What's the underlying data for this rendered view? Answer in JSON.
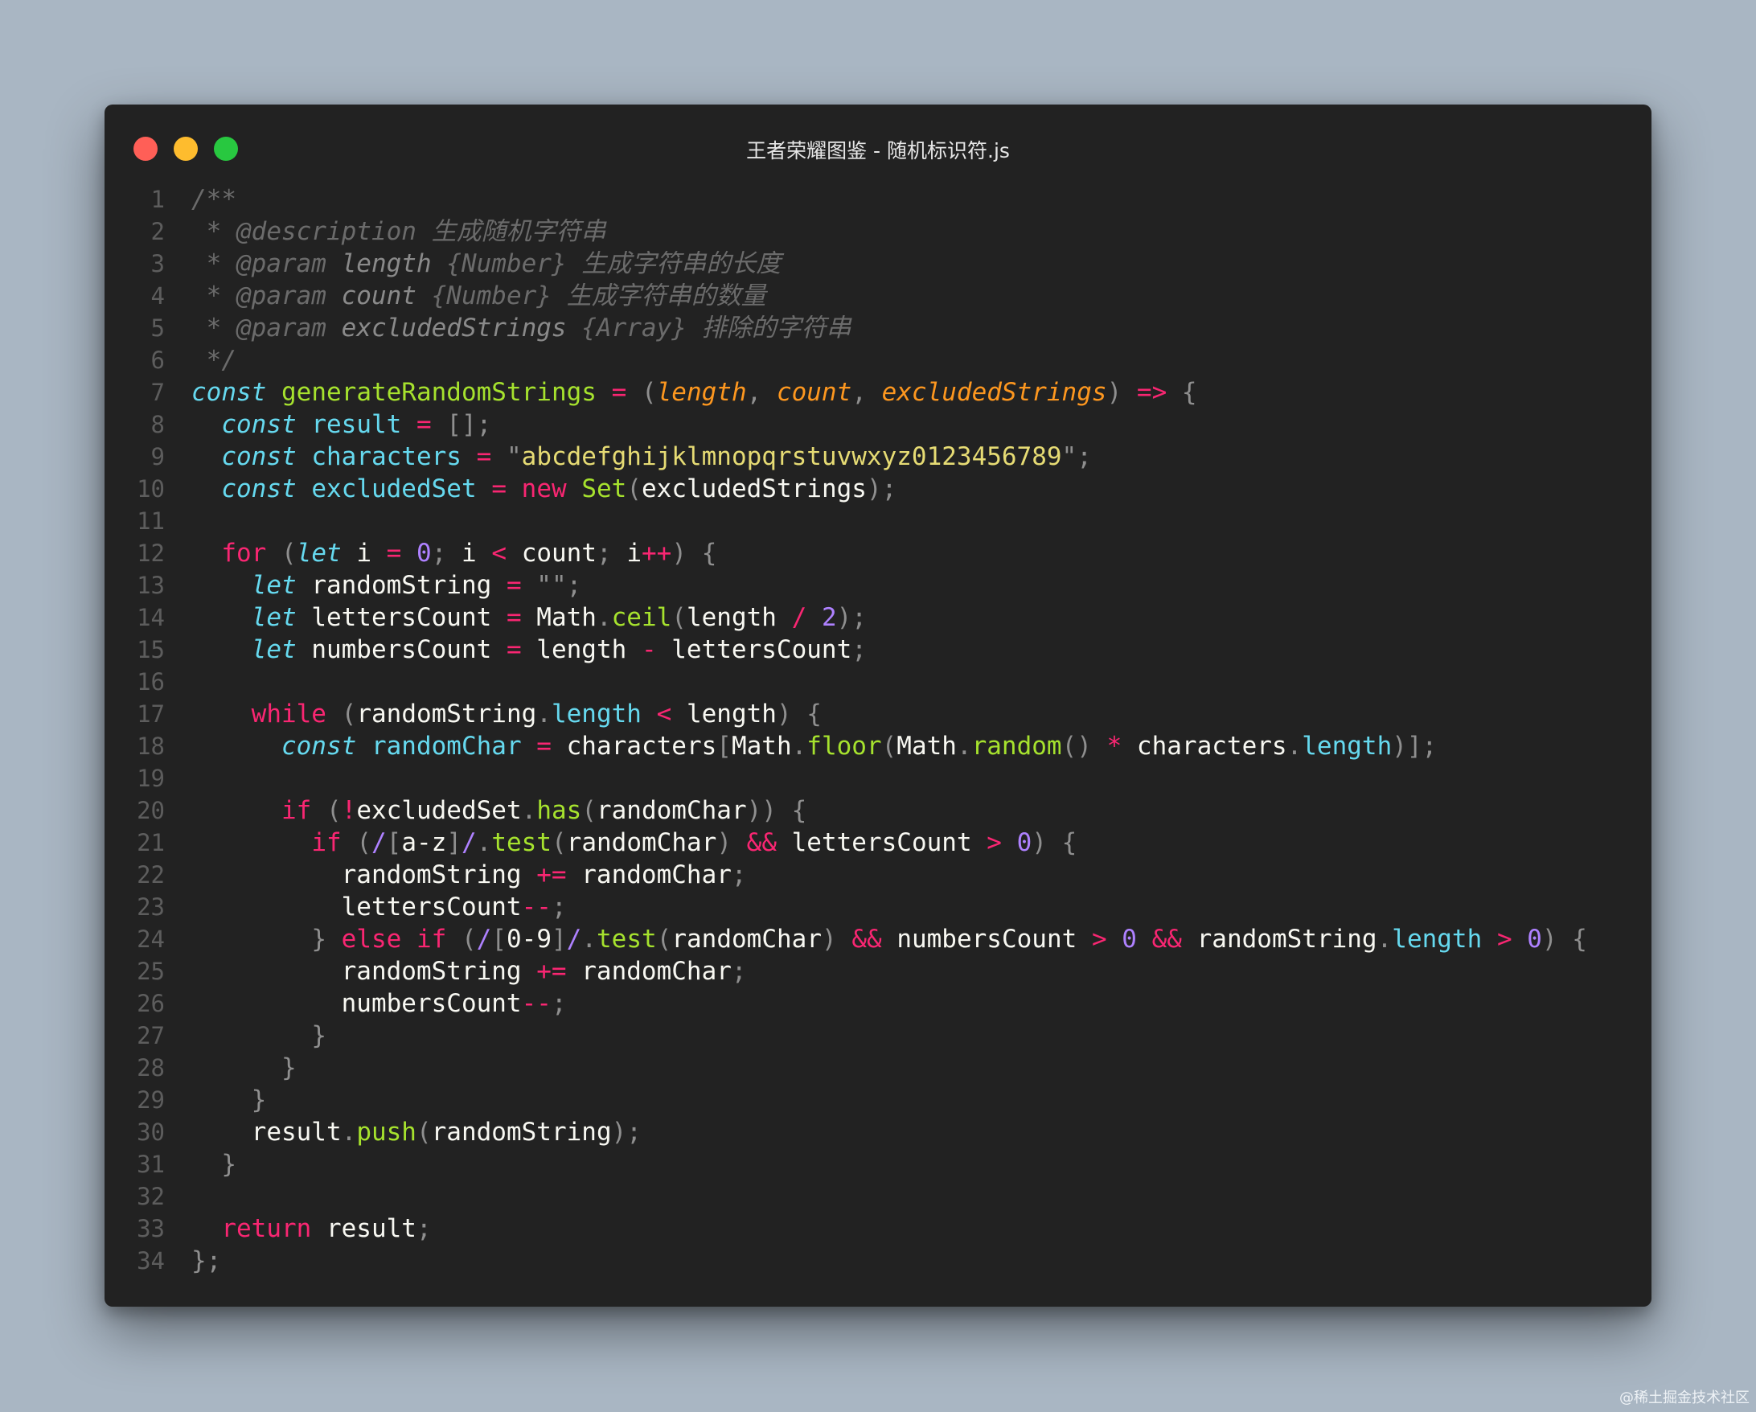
{
  "window": {
    "title": "王者荣耀图鉴 - 随机标识符.js",
    "controls": [
      "close",
      "minimize",
      "zoom"
    ]
  },
  "colors": {
    "background": "#a9b6c3",
    "editor": "#222222",
    "close": "#ff5f57",
    "minimize": "#febc2e",
    "zoom": "#28c840"
  },
  "watermark": "@稀土掘金技术社区",
  "code_lines": [
    {
      "n": "1",
      "t": [
        [
          "comment",
          "/**"
        ]
      ]
    },
    {
      "n": "2",
      "t": [
        [
          "comment",
          " * @description 生成随机字符串"
        ]
      ]
    },
    {
      "n": "3",
      "t": [
        [
          "comment",
          " * @param "
        ],
        [
          "doctype",
          "length"
        ],
        [
          "comment",
          " {Number} 生成字符串的长度"
        ]
      ]
    },
    {
      "n": "4",
      "t": [
        [
          "comment",
          " * @param "
        ],
        [
          "doctype",
          "count"
        ],
        [
          "comment",
          " {Number} 生成字符串的数量"
        ]
      ]
    },
    {
      "n": "5",
      "t": [
        [
          "comment",
          " * @param "
        ],
        [
          "doctype",
          "excludedStrings"
        ],
        [
          "comment",
          " {Array} 排除的字符串"
        ]
      ]
    },
    {
      "n": "6",
      "t": [
        [
          "comment",
          " */"
        ]
      ]
    },
    {
      "n": "7",
      "t": [
        [
          "keyword",
          "const"
        ],
        [
          "variable",
          " "
        ],
        [
          "function",
          "generateRandomStrings"
        ],
        [
          "variable",
          " "
        ],
        [
          "operator",
          "="
        ],
        [
          "variable",
          " "
        ],
        [
          "punct",
          "("
        ],
        [
          "param",
          "length"
        ],
        [
          "punct",
          ", "
        ],
        [
          "param",
          "count"
        ],
        [
          "punct",
          ", "
        ],
        [
          "param",
          "excludedStrings"
        ],
        [
          "punct",
          ")"
        ],
        [
          "variable",
          " "
        ],
        [
          "operator",
          "=>"
        ],
        [
          "variable",
          " "
        ],
        [
          "punct",
          "{"
        ]
      ]
    },
    {
      "n": "8",
      "t": [
        [
          "variable",
          "  "
        ],
        [
          "keyword",
          "const"
        ],
        [
          "variable",
          " "
        ],
        [
          "const-var",
          "result"
        ],
        [
          "variable",
          " "
        ],
        [
          "operator",
          "="
        ],
        [
          "variable",
          " "
        ],
        [
          "punct",
          "[];"
        ]
      ]
    },
    {
      "n": "9",
      "t": [
        [
          "variable",
          "  "
        ],
        [
          "keyword",
          "const"
        ],
        [
          "variable",
          " "
        ],
        [
          "const-var",
          "characters"
        ],
        [
          "variable",
          " "
        ],
        [
          "operator",
          "="
        ],
        [
          "variable",
          " "
        ],
        [
          "punct",
          "\""
        ],
        [
          "string",
          "abcdefghijklmnopqrstuvwxyz0123456789"
        ],
        [
          "punct",
          "\";"
        ]
      ]
    },
    {
      "n": "10",
      "t": [
        [
          "variable",
          "  "
        ],
        [
          "keyword",
          "const"
        ],
        [
          "variable",
          " "
        ],
        [
          "const-var",
          "excludedSet"
        ],
        [
          "variable",
          " "
        ],
        [
          "operator",
          "="
        ],
        [
          "variable",
          " "
        ],
        [
          "control",
          "new"
        ],
        [
          "variable",
          " "
        ],
        [
          "builtin",
          "Set"
        ],
        [
          "punct",
          "("
        ],
        [
          "variable",
          "excludedStrings"
        ],
        [
          "punct",
          ");"
        ]
      ]
    },
    {
      "n": "11",
      "t": []
    },
    {
      "n": "12",
      "t": [
        [
          "variable",
          "  "
        ],
        [
          "control",
          "for"
        ],
        [
          "variable",
          " "
        ],
        [
          "punct",
          "("
        ],
        [
          "keyword",
          "let"
        ],
        [
          "variable",
          " i "
        ],
        [
          "operator",
          "="
        ],
        [
          "variable",
          " "
        ],
        [
          "number",
          "0"
        ],
        [
          "punct",
          ";"
        ],
        [
          "variable",
          " i "
        ],
        [
          "operator",
          "<"
        ],
        [
          "variable",
          " count"
        ],
        [
          "punct",
          ";"
        ],
        [
          "variable",
          " i"
        ],
        [
          "operator",
          "++"
        ],
        [
          "punct",
          ")"
        ],
        [
          "variable",
          " "
        ],
        [
          "punct",
          "{"
        ]
      ]
    },
    {
      "n": "13",
      "t": [
        [
          "variable",
          "    "
        ],
        [
          "keyword",
          "let"
        ],
        [
          "variable",
          " randomString "
        ],
        [
          "operator",
          "="
        ],
        [
          "variable",
          " "
        ],
        [
          "punct",
          "\"\";"
        ]
      ]
    },
    {
      "n": "14",
      "t": [
        [
          "variable",
          "    "
        ],
        [
          "keyword",
          "let"
        ],
        [
          "variable",
          " lettersCount "
        ],
        [
          "operator",
          "="
        ],
        [
          "variable",
          " Math"
        ],
        [
          "punct",
          "."
        ],
        [
          "function",
          "ceil"
        ],
        [
          "punct",
          "("
        ],
        [
          "variable",
          "length "
        ],
        [
          "operator",
          "/"
        ],
        [
          "variable",
          " "
        ],
        [
          "number",
          "2"
        ],
        [
          "punct",
          ");"
        ]
      ]
    },
    {
      "n": "15",
      "t": [
        [
          "variable",
          "    "
        ],
        [
          "keyword",
          "let"
        ],
        [
          "variable",
          " numbersCount "
        ],
        [
          "operator",
          "="
        ],
        [
          "variable",
          " length "
        ],
        [
          "operator",
          "-"
        ],
        [
          "variable",
          " lettersCount"
        ],
        [
          "punct",
          ";"
        ]
      ]
    },
    {
      "n": "16",
      "t": []
    },
    {
      "n": "17",
      "t": [
        [
          "variable",
          "    "
        ],
        [
          "control",
          "while"
        ],
        [
          "variable",
          " "
        ],
        [
          "punct",
          "("
        ],
        [
          "variable",
          "randomString"
        ],
        [
          "punct",
          "."
        ],
        [
          "property",
          "length"
        ],
        [
          "variable",
          " "
        ],
        [
          "operator",
          "<"
        ],
        [
          "variable",
          " length"
        ],
        [
          "punct",
          ")"
        ],
        [
          "variable",
          " "
        ],
        [
          "punct",
          "{"
        ]
      ]
    },
    {
      "n": "18",
      "t": [
        [
          "variable",
          "      "
        ],
        [
          "keyword",
          "const"
        ],
        [
          "variable",
          " "
        ],
        [
          "const-var",
          "randomChar"
        ],
        [
          "variable",
          " "
        ],
        [
          "operator",
          "="
        ],
        [
          "variable",
          " characters"
        ],
        [
          "punct",
          "["
        ],
        [
          "variable",
          "Math"
        ],
        [
          "punct",
          "."
        ],
        [
          "function",
          "floor"
        ],
        [
          "punct",
          "("
        ],
        [
          "variable",
          "Math"
        ],
        [
          "punct",
          "."
        ],
        [
          "function",
          "random"
        ],
        [
          "punct",
          "()"
        ],
        [
          "variable",
          " "
        ],
        [
          "operator",
          "*"
        ],
        [
          "variable",
          " characters"
        ],
        [
          "punct",
          "."
        ],
        [
          "property",
          "length"
        ],
        [
          "punct",
          ")];"
        ]
      ]
    },
    {
      "n": "19",
      "t": []
    },
    {
      "n": "20",
      "t": [
        [
          "variable",
          "      "
        ],
        [
          "control",
          "if"
        ],
        [
          "variable",
          " "
        ],
        [
          "punct",
          "("
        ],
        [
          "operator",
          "!"
        ],
        [
          "variable",
          "excludedSet"
        ],
        [
          "punct",
          "."
        ],
        [
          "function",
          "has"
        ],
        [
          "punct",
          "("
        ],
        [
          "variable",
          "randomChar"
        ],
        [
          "punct",
          "))"
        ],
        [
          "variable",
          " "
        ],
        [
          "punct",
          "{"
        ]
      ]
    },
    {
      "n": "21",
      "t": [
        [
          "variable",
          "        "
        ],
        [
          "control",
          "if"
        ],
        [
          "variable",
          " "
        ],
        [
          "punct",
          "("
        ],
        [
          "regex",
          "/"
        ],
        [
          "punct",
          "["
        ],
        [
          "variable",
          "a-z"
        ],
        [
          "punct",
          "]"
        ],
        [
          "regex",
          "/"
        ],
        [
          "punct",
          "."
        ],
        [
          "function",
          "test"
        ],
        [
          "punct",
          "("
        ],
        [
          "variable",
          "randomChar"
        ],
        [
          "punct",
          ")"
        ],
        [
          "variable",
          " "
        ],
        [
          "operator",
          "&&"
        ],
        [
          "variable",
          " lettersCount "
        ],
        [
          "operator",
          ">"
        ],
        [
          "variable",
          " "
        ],
        [
          "number",
          "0"
        ],
        [
          "punct",
          ")"
        ],
        [
          "variable",
          " "
        ],
        [
          "punct",
          "{"
        ]
      ]
    },
    {
      "n": "22",
      "t": [
        [
          "variable",
          "          randomString "
        ],
        [
          "operator",
          "+="
        ],
        [
          "variable",
          " randomChar"
        ],
        [
          "punct",
          ";"
        ]
      ]
    },
    {
      "n": "23",
      "t": [
        [
          "variable",
          "          lettersCount"
        ],
        [
          "operator",
          "--"
        ],
        [
          "punct",
          ";"
        ]
      ]
    },
    {
      "n": "24",
      "t": [
        [
          "variable",
          "        "
        ],
        [
          "punct",
          "}"
        ],
        [
          "variable",
          " "
        ],
        [
          "control",
          "else if"
        ],
        [
          "variable",
          " "
        ],
        [
          "punct",
          "("
        ],
        [
          "regex",
          "/"
        ],
        [
          "punct",
          "["
        ],
        [
          "variable",
          "0-9"
        ],
        [
          "punct",
          "]"
        ],
        [
          "regex",
          "/"
        ],
        [
          "punct",
          "."
        ],
        [
          "function",
          "test"
        ],
        [
          "punct",
          "("
        ],
        [
          "variable",
          "randomChar"
        ],
        [
          "punct",
          ")"
        ],
        [
          "variable",
          " "
        ],
        [
          "operator",
          "&&"
        ],
        [
          "variable",
          " numbersCount "
        ],
        [
          "operator",
          ">"
        ],
        [
          "variable",
          " "
        ],
        [
          "number",
          "0"
        ],
        [
          "variable",
          " "
        ],
        [
          "operator",
          "&&"
        ],
        [
          "variable",
          " randomString"
        ],
        [
          "punct",
          "."
        ],
        [
          "property",
          "length"
        ],
        [
          "variable",
          " "
        ],
        [
          "operator",
          ">"
        ],
        [
          "variable",
          " "
        ],
        [
          "number",
          "0"
        ],
        [
          "punct",
          ")"
        ],
        [
          "variable",
          " "
        ],
        [
          "punct",
          "{"
        ]
      ]
    },
    {
      "n": "25",
      "t": [
        [
          "variable",
          "          randomString "
        ],
        [
          "operator",
          "+="
        ],
        [
          "variable",
          " randomChar"
        ],
        [
          "punct",
          ";"
        ]
      ]
    },
    {
      "n": "26",
      "t": [
        [
          "variable",
          "          numbersCount"
        ],
        [
          "operator",
          "--"
        ],
        [
          "punct",
          ";"
        ]
      ]
    },
    {
      "n": "27",
      "t": [
        [
          "variable",
          "        "
        ],
        [
          "punct",
          "}"
        ]
      ]
    },
    {
      "n": "28",
      "t": [
        [
          "variable",
          "      "
        ],
        [
          "punct",
          "}"
        ]
      ]
    },
    {
      "n": "29",
      "t": [
        [
          "variable",
          "    "
        ],
        [
          "punct",
          "}"
        ]
      ]
    },
    {
      "n": "30",
      "t": [
        [
          "variable",
          "    result"
        ],
        [
          "punct",
          "."
        ],
        [
          "function",
          "push"
        ],
        [
          "punct",
          "("
        ],
        [
          "variable",
          "randomString"
        ],
        [
          "punct",
          ");"
        ]
      ]
    },
    {
      "n": "31",
      "t": [
        [
          "variable",
          "  "
        ],
        [
          "punct",
          "}"
        ]
      ]
    },
    {
      "n": "32",
      "t": []
    },
    {
      "n": "33",
      "t": [
        [
          "variable",
          "  "
        ],
        [
          "control",
          "return"
        ],
        [
          "variable",
          " result"
        ],
        [
          "punct",
          ";"
        ]
      ]
    },
    {
      "n": "34",
      "t": [
        [
          "punct",
          "};"
        ]
      ]
    }
  ]
}
